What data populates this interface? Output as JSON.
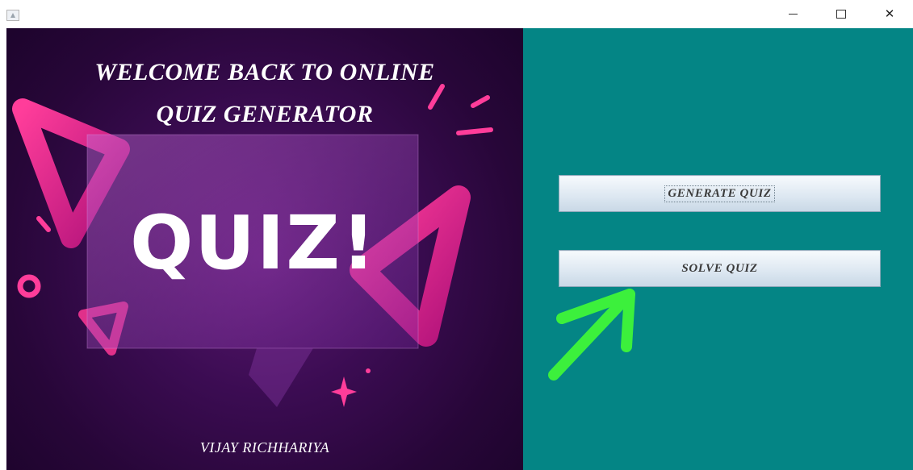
{
  "window": {
    "icon": "java-app-icon",
    "controls": {
      "minimize": "minimize-icon",
      "maximize": "maximize-icon",
      "close_glyph": "✕"
    }
  },
  "left_panel": {
    "welcome_line1": "WELCOME BACK TO ONLINE",
    "welcome_line2": "QUIZ GENERATOR",
    "poster_text": "QUIZ!",
    "author": "VIJAY RICHHARIYA"
  },
  "right_panel": {
    "background_color": "#048585",
    "generate_label": "GENERATE QUIZ",
    "solve_label": "SOLVE QUIZ",
    "annotation_arrow_color": "#3cf03c"
  }
}
